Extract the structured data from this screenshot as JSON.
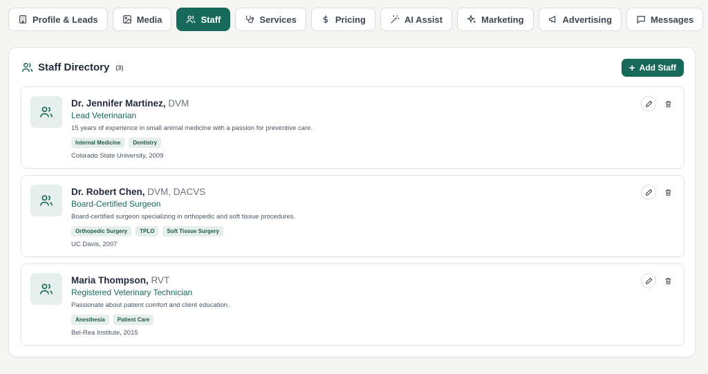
{
  "tabs": [
    {
      "label": "Profile & Leads",
      "icon": "building-icon",
      "active": false
    },
    {
      "label": "Media",
      "icon": "image-icon",
      "active": false
    },
    {
      "label": "Staff",
      "icon": "users-icon",
      "active": true
    },
    {
      "label": "Services",
      "icon": "stethoscope-icon",
      "active": false
    },
    {
      "label": "Pricing",
      "icon": "dollar-icon",
      "active": false
    },
    {
      "label": "AI Assist",
      "icon": "magic-wand-icon",
      "active": false
    },
    {
      "label": "Marketing",
      "icon": "sparkles-icon",
      "active": false
    },
    {
      "label": "Advertising",
      "icon": "megaphone-icon",
      "active": false
    },
    {
      "label": "Messages",
      "icon": "message-icon",
      "active": false
    }
  ],
  "directory": {
    "title": "Staff Directory",
    "count": "(3)",
    "add_label": "Add Staff"
  },
  "staff": [
    {
      "name": "Dr. Jennifer Martinez,",
      "credentials": "DVM",
      "role": "Lead Veterinarian",
      "bio": "15 years of experience in small animal medicine with a passion for preventive care.",
      "specialties": [
        "Internal Medicine",
        "Dentistry"
      ],
      "education": "Colorado State University, 2009"
    },
    {
      "name": "Dr. Robert Chen,",
      "credentials": "DVM, DACVS",
      "role": "Board-Certified Surgeon",
      "bio": "Board-certified surgeon specializing in orthopedic and soft tissue procedures.",
      "specialties": [
        "Orthopedic Surgery",
        "TPLO",
        "Soft Tissue Surgery"
      ],
      "education": "UC Davis, 2007"
    },
    {
      "name": "Maria Thompson,",
      "credentials": "RVT",
      "role": "Registered Veterinary Technician",
      "bio": "Passionate about patient comfort and client education.",
      "specialties": [
        "Anesthesia",
        "Patient Care"
      ],
      "education": "Bel-Rea Institute, 2015"
    }
  ],
  "colors": {
    "accent": "#17695a",
    "chip_bg": "#e6efec"
  }
}
